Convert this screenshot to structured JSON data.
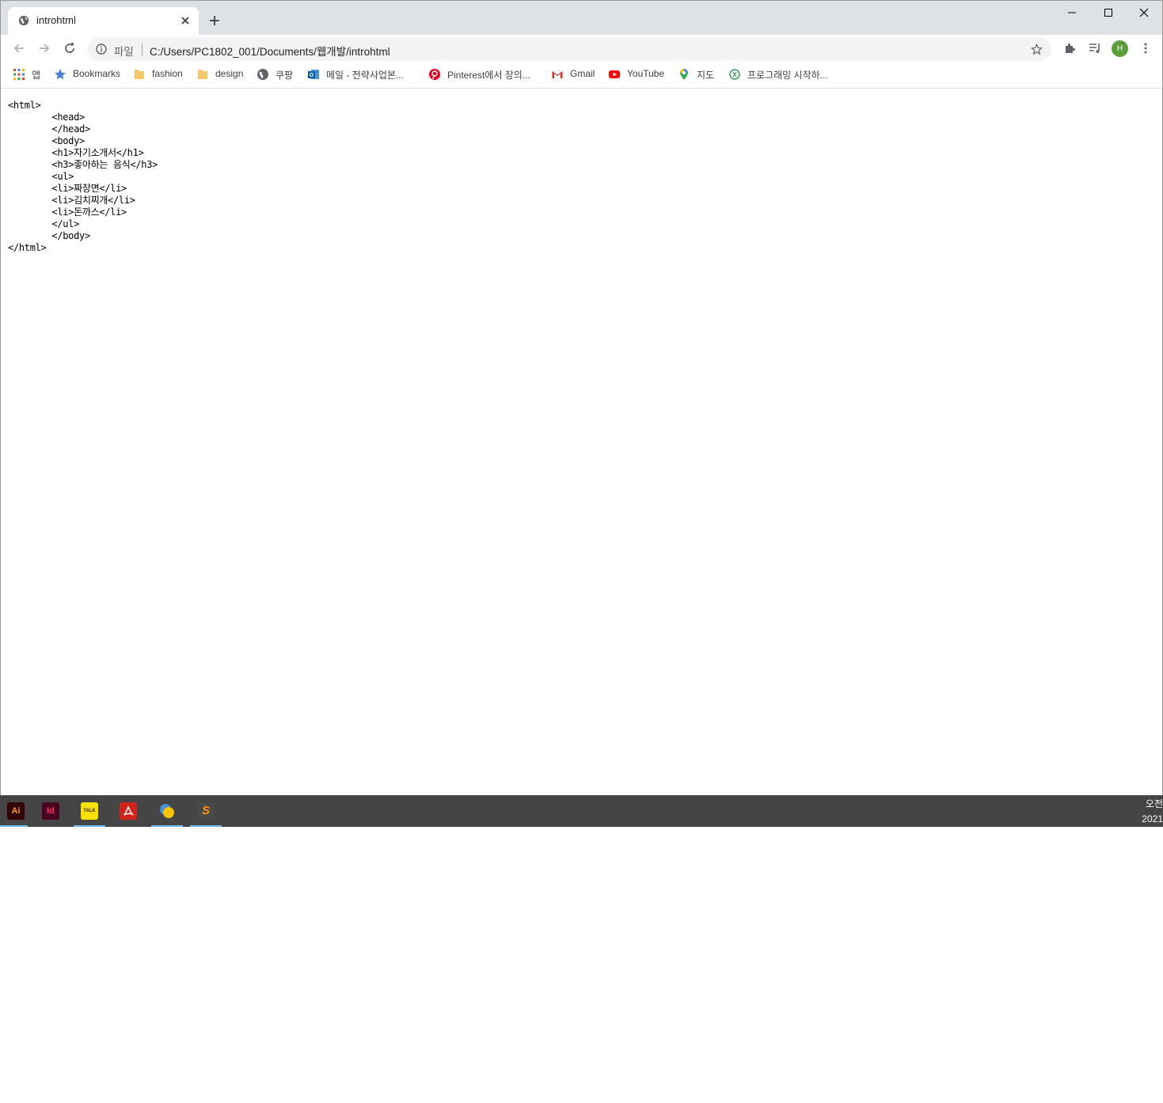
{
  "tab": {
    "title": "introhtml"
  },
  "omnibox": {
    "scheme_label": "파일",
    "url": "C:/Users/PC1802_001/Documents/웹개발/introhtml"
  },
  "profile": {
    "initial": "H",
    "color": "#5a9e3c"
  },
  "bookmarks": [
    {
      "label": "앱",
      "icon": "apps-grid-icon"
    },
    {
      "label": "Bookmarks",
      "icon": "star-icon"
    },
    {
      "label": "fashion",
      "icon": "folder-icon"
    },
    {
      "label": "design",
      "icon": "folder-icon"
    },
    {
      "label": "쿠팡",
      "icon": "globe-icon"
    },
    {
      "label": "메일 - 전략사업본...",
      "icon": "outlook-icon"
    },
    {
      "label": "Pinterest에서 장의...",
      "icon": "pinterest-icon"
    },
    {
      "label": "Gmail",
      "icon": "gmail-icon"
    },
    {
      "label": "YouTube",
      "icon": "youtube-icon"
    },
    {
      "label": "지도",
      "icon": "maps-pin-icon"
    },
    {
      "label": "프로그래밍 시작하...",
      "icon": "site-icon"
    }
  ],
  "page": {
    "source_lines": [
      "<html>",
      "        <head>",
      "        </head>",
      "        <body>",
      "        <h1>자기소개서</h1>",
      "        <h3>좋아하는 음식</h3>",
      "        <ul>",
      "        <li>짜장면</li>",
      "        <li>김치찌개</li>",
      "        <li>돈까스</li>",
      "        </ul>",
      "        </body>",
      "</html>"
    ]
  },
  "taskbar": {
    "apps": [
      {
        "name": "illustrator",
        "label": "Ai"
      },
      {
        "name": "indesign",
        "label": "Id"
      },
      {
        "name": "kakaotalk",
        "label": "TALK"
      },
      {
        "name": "acrobat",
        "label": ""
      },
      {
        "name": "chrome-canary",
        "label": ""
      },
      {
        "name": "sublime-text",
        "label": "S"
      }
    ],
    "clock_line1": "오전",
    "clock_line2": "2021"
  }
}
